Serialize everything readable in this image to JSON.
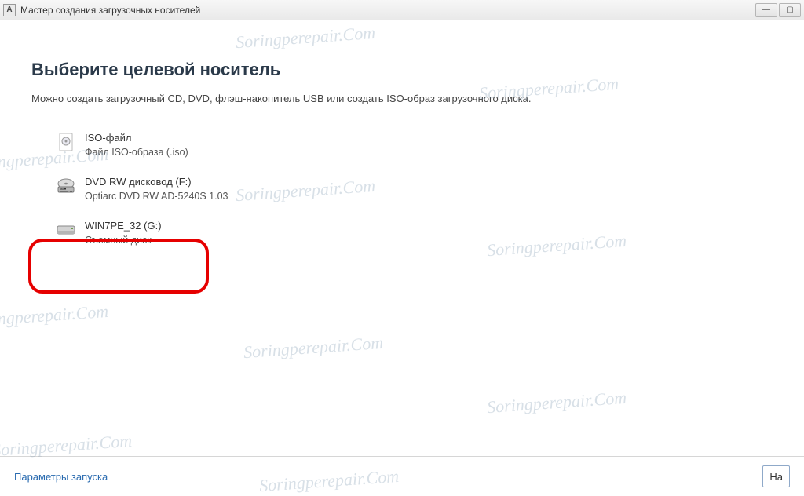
{
  "window": {
    "app_icon_letter": "A",
    "title": "Мастер создания загрузочных носителей"
  },
  "page": {
    "title": "Выберите целевой носитель",
    "subtitle": "Можно создать загрузочный CD, DVD, флэш-накопитель USB или создать ISO-образ загрузочного диска."
  },
  "media_options": [
    {
      "title": "ISO-файл",
      "desc": "Файл ISO-образа (.iso)",
      "icon": "iso"
    },
    {
      "title": "DVD RW дисковод (F:)",
      "desc": "Optiarc DVD RW AD-5240S 1.03",
      "icon": "dvd"
    },
    {
      "title": "WIN7PE_32 (G:)",
      "desc": "Съемный диск",
      "icon": "usb"
    }
  ],
  "footer": {
    "params_link": "Параметры запуска",
    "next_button": "На"
  },
  "watermark_text": "Soringperepair.Com"
}
